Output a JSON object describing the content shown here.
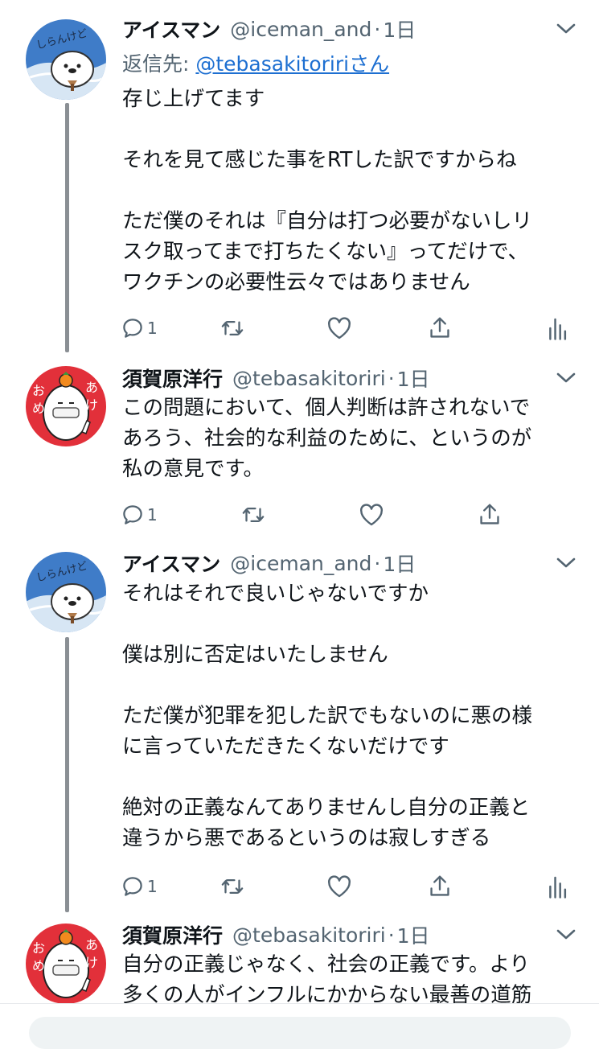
{
  "tweets": [
    {
      "name": "アイスマン",
      "handle": "@iceman_and",
      "dot": "·",
      "time": "1日",
      "reply_prefix": "返信先: ",
      "reply_handle": "@tebasakitoriri",
      "reply_suffix": "さん",
      "lines": [
        "存じ上げてます",
        "",
        "それを見て感じた事をRTした訳ですからね",
        "",
        "ただ僕のそれは『自分は打つ必要がないしリ",
        "スク取ってまで打ちたくない』ってだけで、",
        "ワクチンの必要性云々ではありません"
      ],
      "reply_count": "1",
      "avatar_text": "しらんけど",
      "avatar_colors": {
        "bg": "#3f7cc8",
        "wave": "#d7e6f4"
      }
    },
    {
      "name": "須賀原洋行",
      "handle": "@tebasakitoriri",
      "dot": "·",
      "time": "1日",
      "lines": [
        "この問題において、個人判断は許されないで",
        "あろう、社会的な利益のために、というのが",
        "私の意見です。"
      ],
      "reply_count": "1",
      "avatar_left": "おめ",
      "avatar_right": "あけ",
      "avatar_colors": {
        "bg": "#e2303a",
        "face": "#ffffff"
      }
    },
    {
      "name": "アイスマン",
      "handle": "@iceman_and",
      "dot": "·",
      "time": "1日",
      "lines": [
        "それはそれで良いじゃないですか",
        "",
        "僕は別に否定はいたしません",
        "",
        "ただ僕が犯罪を犯した訳でもないのに悪の様",
        "に言っていただきたくないだけです",
        "",
        "絶対の正義なんてありませんし自分の正義と",
        "違うから悪であるというのは寂しすぎる"
      ],
      "reply_count": "1",
      "avatar_text": "しらんけど"
    },
    {
      "name": "須賀原洋行",
      "handle": "@tebasakitoriri",
      "dot": "·",
      "time": "1日",
      "lines": [
        "自分の正義じゃなく、社会の正義です。より",
        "多くの人がインフルにかからない最善の道筋"
      ],
      "avatar_left": "おめ",
      "avatar_right": "あけ"
    }
  ],
  "icons": {
    "reply": "reply-icon",
    "retweet": "retweet-icon",
    "like": "heart-icon",
    "share": "share-icon",
    "analytics": "analytics-icon",
    "more": "chevron-down-icon"
  },
  "colors": {
    "link": "#1d6fd1",
    "secondary": "#536471",
    "thread_line": "#8a8f94"
  }
}
